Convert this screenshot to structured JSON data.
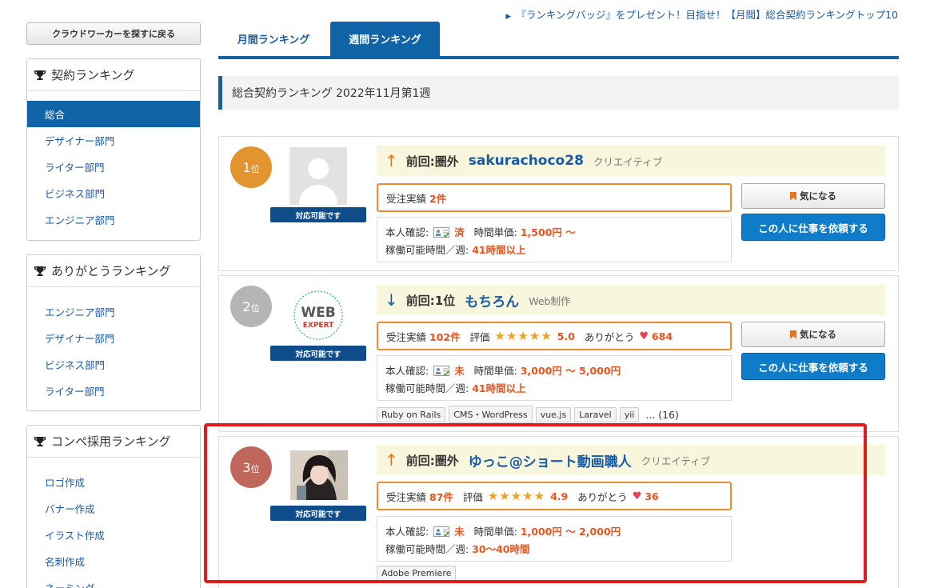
{
  "sidebar": {
    "back_label": "クラウドワーカーを探すに戻る",
    "contract": {
      "title": "契約ランキング",
      "items": [
        "総合",
        "デザイナー部門",
        "ライター部門",
        "ビジネス部門",
        "エンジニア部門"
      ],
      "active_index": 0
    },
    "thanks": {
      "title": "ありがとうランキング",
      "items": [
        "エンジニア部門",
        "デザイナー部門",
        "ビジネス部門",
        "ライター部門"
      ]
    },
    "contest": {
      "title": "コンペ採用ランキング",
      "items": [
        "ロゴ作成",
        "バナー作成",
        "イラスト作成",
        "名刺作成",
        "ネーミング"
      ]
    }
  },
  "top_link": "『ランキングバッジ』をプレゼント！目指せ！【月間】総合契約ランキングトップ10",
  "tabs": {
    "monthly": "月間ランキング",
    "weekly": "週間ランキング",
    "active": "weekly"
  },
  "section_title": "総合契約ランキング 2022年11月第1週",
  "labels": {
    "available": "対応可能です",
    "orders": "受注実績",
    "rating": "評価",
    "thanks": "ありがとう",
    "id_check": "本人確認:",
    "hourly": "時間単価:",
    "hours": "稼働可能時間／週:",
    "fav_button": "気になる",
    "request_button": "この人に仕事を依頼する",
    "rank_suffix": "位"
  },
  "rankings": [
    {
      "rank": "1",
      "trend": "↑",
      "prev": "前回:圏外",
      "username": "sakurachoco28",
      "category": "クリエイティブ",
      "orders": "2件",
      "id_status": "済",
      "rate": "1,500円 ～",
      "hours": "41時間以上",
      "rank_color": "#e2952f"
    },
    {
      "rank": "2",
      "trend": "↓",
      "prev": "前回:1位",
      "username": "もちろん",
      "category": "Web制作",
      "orders": "102件",
      "stars": "★★★★★",
      "score": "5.0",
      "thanks_count": "684",
      "id_status": "未",
      "rate": "3,000円 ～ 5,000円",
      "hours": "41時間以上",
      "skills": [
        "Ruby on Rails",
        "CMS・WordPress",
        "vue.js",
        "Laravel",
        "yii"
      ],
      "more": "... (16)",
      "logo_text_1": "WEB",
      "logo_text_2": "EXPERT",
      "rank_color": "#b5b5b5"
    },
    {
      "rank": "3",
      "trend": "↑",
      "prev": "前回:圏外",
      "username": "ゆっこ@ショート動画職人",
      "category": "クリエイティブ",
      "orders": "87件",
      "stars": "★★★★★",
      "score": "4.9",
      "thanks_count": "36",
      "id_status": "未",
      "rate": "1,000円 ～ 2,000円",
      "hours": "30～40時間",
      "skills": [
        "Adobe Premiere"
      ],
      "rank_color": "#c0675c"
    }
  ],
  "colors": {
    "brand": "#0f64a8",
    "accent": "#e8541d",
    "highlight": "#e21b1b"
  }
}
